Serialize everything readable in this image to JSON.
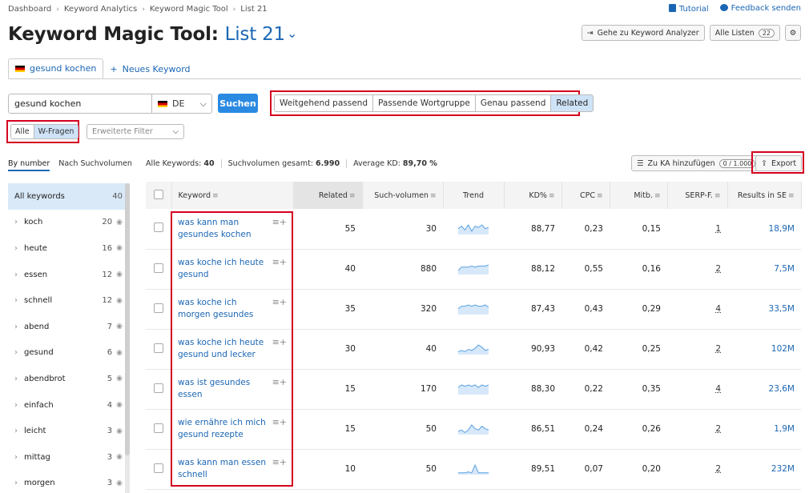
{
  "breadcrumb": [
    "Dashboard",
    "Keyword Analytics",
    "Keyword Magic Tool",
    "List 21"
  ],
  "top_links": {
    "tutorial": "Tutorial",
    "feedback": "Feedback senden"
  },
  "page_title": {
    "tool": "Keyword Magic Tool:",
    "list": "List 21"
  },
  "header_buttons": {
    "analyzer": "Gehe zu Keyword Analyzer",
    "all_lists": "Alle Listen",
    "all_lists_count": "22"
  },
  "tabs": [
    {
      "label": "gesund kochen"
    },
    {
      "label": "Neues Keyword"
    }
  ],
  "search": {
    "value": "gesund kochen",
    "country": "DE",
    "button": "Suchen"
  },
  "match_types": [
    "Weitgehend passend",
    "Passende Wortgruppe",
    "Genau passend",
    "Related"
  ],
  "match_active": "Related",
  "question_toggle": [
    "Alle",
    "W-Fragen"
  ],
  "filter_placeholder": "Erweiterte Filter",
  "sort_options": [
    "By number",
    "Nach Suchvolumen"
  ],
  "stats": {
    "all_label": "Alle Keywords:",
    "all_value": "40",
    "volume_label": "Suchvolumen gesamt:",
    "volume_value": "6.990",
    "kd_label": "Average KD:",
    "kd_value": "89,70 %"
  },
  "actions": {
    "add_ka": "Zu KA hinzufügen",
    "add_ka_count": "0 / 1.000",
    "export": "Export"
  },
  "sidebar": [
    {
      "label": "All keywords",
      "count": "40"
    },
    {
      "label": "koch",
      "count": "20"
    },
    {
      "label": "heute",
      "count": "16"
    },
    {
      "label": "essen",
      "count": "12"
    },
    {
      "label": "schnell",
      "count": "12"
    },
    {
      "label": "abend",
      "count": "7"
    },
    {
      "label": "gesund",
      "count": "6"
    },
    {
      "label": "abendbrot",
      "count": "5"
    },
    {
      "label": "einfach",
      "count": "4"
    },
    {
      "label": "leicht",
      "count": "3"
    },
    {
      "label": "mittag",
      "count": "3"
    },
    {
      "label": "morgen",
      "count": "3"
    }
  ],
  "columns": [
    "Keyword",
    "Related",
    "Such-volumen",
    "Trend",
    "KD%",
    "CPC",
    "Mitb.",
    "SERP-F.",
    "Results in SE"
  ],
  "rows": [
    {
      "keyword": [
        "was kann man",
        "gesundes kochen"
      ],
      "related": "55",
      "volume": "30",
      "trend": [
        4,
        6,
        3,
        7,
        2,
        6,
        5,
        7,
        4,
        5
      ],
      "kd": "88,77",
      "cpc": "0,23",
      "comp": "0,15",
      "serp": "1",
      "results": "18,9M"
    },
    {
      "keyword": [
        "was koche ich heute",
        "gesund"
      ],
      "related": "40",
      "volume": "880",
      "trend": [
        3,
        6,
        6,
        6,
        7,
        6,
        7,
        7,
        7,
        8
      ],
      "kd": "88,12",
      "cpc": "0,55",
      "comp": "0,16",
      "serp": "2",
      "results": "7,5M"
    },
    {
      "keyword": [
        "was koche ich",
        "morgen gesundes"
      ],
      "related": "35",
      "volume": "320",
      "trend": [
        4,
        6,
        6,
        7,
        6,
        7,
        6,
        6,
        7,
        5
      ],
      "kd": "87,43",
      "cpc": "0,43",
      "comp": "0,29",
      "serp": "4",
      "results": "33,5M"
    },
    {
      "keyword": [
        "was koche ich heute",
        "gesund und lecker"
      ],
      "related": "30",
      "volume": "40",
      "trend": [
        2,
        3,
        2,
        4,
        3,
        5,
        8,
        6,
        3,
        4
      ],
      "kd": "90,93",
      "cpc": "0,42",
      "comp": "0,25",
      "serp": "2",
      "results": "102M"
    },
    {
      "keyword": [
        "was ist gesundes",
        "essen"
      ],
      "related": "15",
      "volume": "170",
      "trend": [
        5,
        7,
        6,
        7,
        6,
        7,
        5,
        7,
        6,
        7
      ],
      "kd": "88,30",
      "cpc": "0,22",
      "comp": "0,35",
      "serp": "4",
      "results": "23,6M"
    },
    {
      "keyword": [
        "wie ernähre ich mich",
        "gesund rezepte"
      ],
      "related": "15",
      "volume": "50",
      "trend": [
        2,
        3,
        1,
        3,
        7,
        4,
        3,
        6,
        4,
        3
      ],
      "kd": "86,51",
      "cpc": "0,24",
      "comp": "0,26",
      "serp": "2",
      "results": "1,9M"
    },
    {
      "keyword": [
        "was kann man essen",
        "schnell"
      ],
      "related": "10",
      "volume": "50",
      "trend": [
        1,
        1,
        1,
        2,
        1,
        9,
        1,
        1,
        1,
        1
      ],
      "kd": "89,51",
      "cpc": "0,07",
      "comp": "0,20",
      "serp": "2",
      "results": "232M"
    }
  ],
  "colors": {
    "accent": "#1b66b4",
    "primary_button": "#2a8ae2",
    "highlight": "#d4001f",
    "selected": "#cfe3f7"
  }
}
